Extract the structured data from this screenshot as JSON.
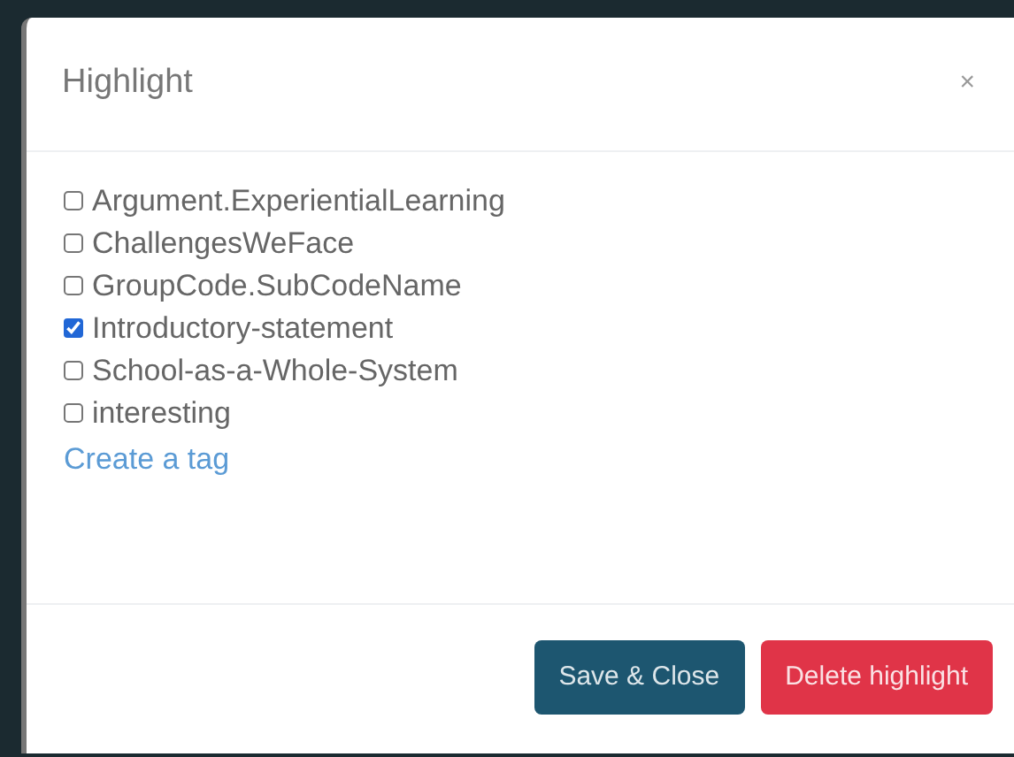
{
  "dialog": {
    "title": "Highlight",
    "close": "×"
  },
  "tags": [
    {
      "label": "Argument.ExperientialLearning",
      "checked": false
    },
    {
      "label": "ChallengesWeFace",
      "checked": false
    },
    {
      "label": "GroupCode.SubCodeName",
      "checked": false
    },
    {
      "label": "Introductory-statement",
      "checked": true
    },
    {
      "label": "School-as-a-Whole-System",
      "checked": false
    },
    {
      "label": "interesting",
      "checked": false
    }
  ],
  "create_link": "Create a tag",
  "buttons": [
    {
      "label": "Save & Close",
      "kind": "primary"
    },
    {
      "label": "Delete highlight",
      "kind": "danger"
    }
  ]
}
